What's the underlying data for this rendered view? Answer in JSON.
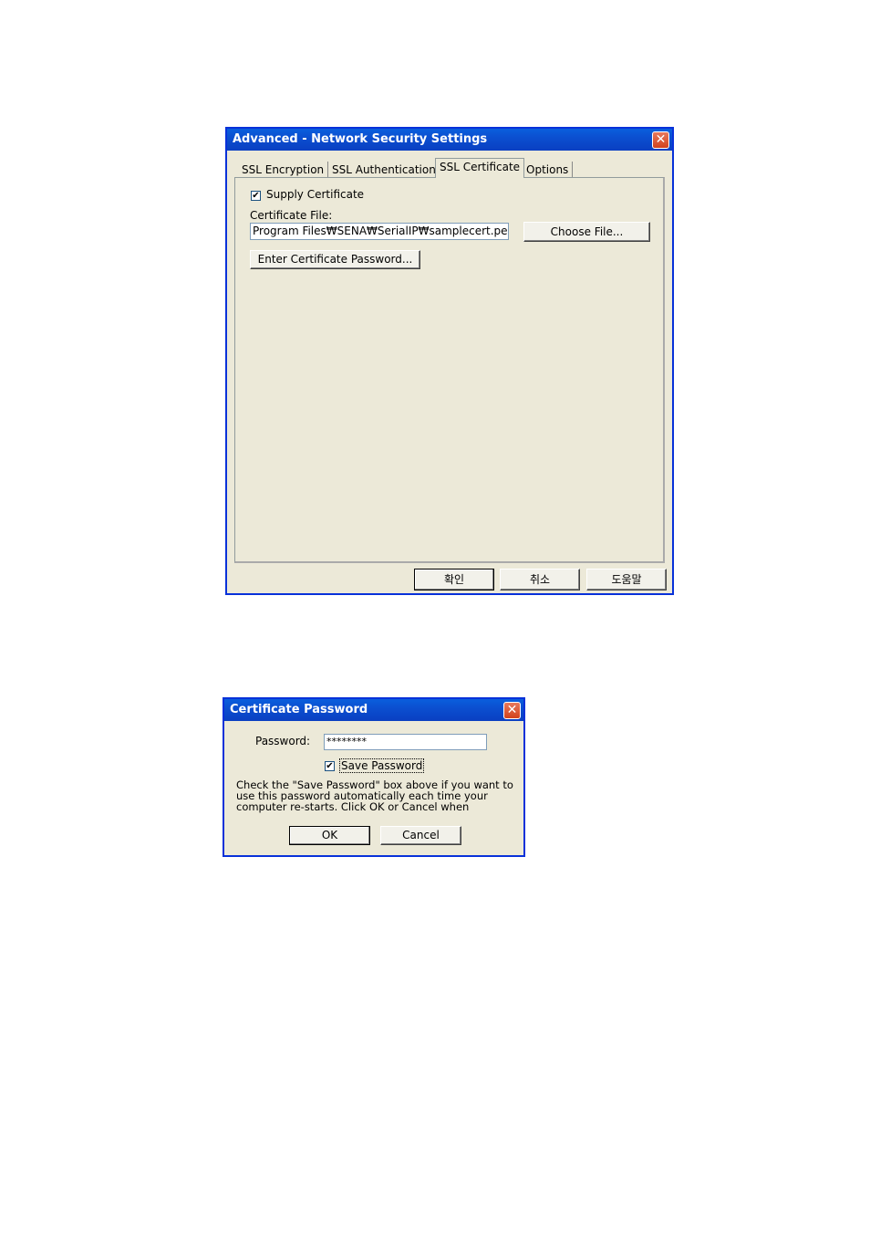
{
  "main_dialog": {
    "title": "Advanced - Network Security Settings",
    "tabs": [
      "SSL Encryption",
      "SSL Authentication",
      "SSL Certificate",
      "Options"
    ],
    "active_tab": "SSL Certificate",
    "supply_certificate_label": "Supply Certificate",
    "supply_certificate_checked": true,
    "certificate_file_label": "Certificate File:",
    "certificate_file_value": "Program Files₩SENA₩SerialIP₩samplecert.pem",
    "choose_file_label": "Choose File...",
    "enter_password_label": "Enter Certificate Password...",
    "ok_label": "확인",
    "cancel_label": "취소",
    "help_label": "도움말"
  },
  "password_dialog": {
    "title": "Certificate Password",
    "password_label": "Password:",
    "password_value": "********",
    "save_password_label": "Save Password",
    "save_password_checked": true,
    "help_text_line1": "Check the \"Save Password\" box above if you want to",
    "help_text_line2": "use this password automatically each time your",
    "help_text_line3": "computer re-starts. Click OK or Cancel when",
    "ok_label": "OK",
    "cancel_label": "Cancel"
  },
  "colors": {
    "title_bar": "#0a4fd0",
    "dialog_face": "#ece9d8",
    "close_button": "#d2421c"
  },
  "icons": [
    "close-icon",
    "checkmark-icon"
  ]
}
